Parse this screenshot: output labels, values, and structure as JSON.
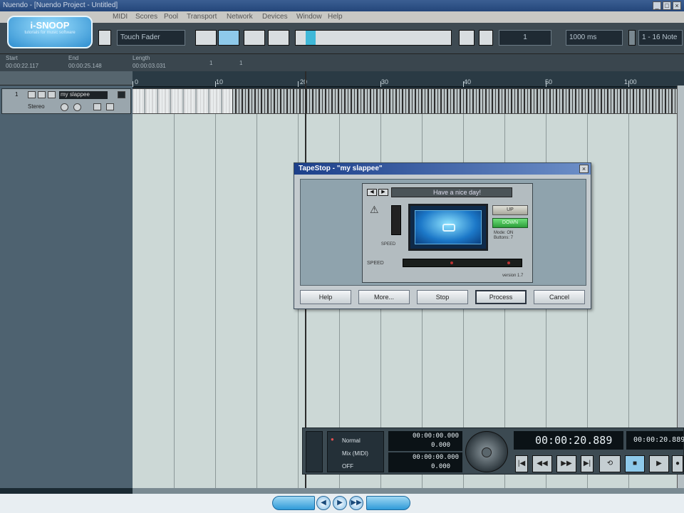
{
  "window": {
    "title": "Nuendo - [Nuendo Project - Untitled]",
    "min": "_",
    "max": "□",
    "close": "×"
  },
  "menu": [
    "MIDI",
    "Scores",
    "Pool",
    "Transport",
    "Network",
    "Devices",
    "Window",
    "Help"
  ],
  "toolbar": {
    "automation_mode": "Touch Fader",
    "snap_value": "1000 ms",
    "quantize": "1 - 16 Note",
    "center_value": "1"
  },
  "logo": {
    "text": "i-SNOOP",
    "tagline": "tutorials for music software"
  },
  "infoline": {
    "start_label": "Start",
    "start_value": "00:00:22.117",
    "end_label": "End",
    "end_value": "00:00:25.148",
    "length_label": "Length",
    "length_value": "00:00:03.031",
    "n1": "1",
    "n2": "1"
  },
  "ruler": {
    "labels": [
      "0",
      "10",
      "20",
      "30",
      "40",
      "50",
      "1:00"
    ]
  },
  "track": {
    "number": "1",
    "name": "my slappee",
    "type": "Stereo"
  },
  "dialog": {
    "title": "TapeStop - \"my slappee\"",
    "preset": "Have a nice day!",
    "lever_label": "SPEED",
    "up_label": "UP",
    "down_label": "DOWN",
    "mode_line1": "Mode: ON",
    "mode_line2": "Buttons: 7",
    "speed_label": "SPEED",
    "version": "version 1.7",
    "buttons": {
      "help": "Help",
      "more": "More...",
      "stop": "Stop",
      "process": "Process",
      "cancel": "Cancel"
    }
  },
  "transport": {
    "normal": "Normal",
    "mix": "Mix (MIDI)",
    "off": "OFF",
    "left_time": "00:00:00.000",
    "left_sub": "0.000",
    "right_time": "00:00:00.000",
    "right_sub": "0.000",
    "primary_time": "00:00:20.889",
    "secondary_time": "00:00:20.889"
  },
  "player": {
    "prev": "◀",
    "play": "▶",
    "next": "▶▶"
  }
}
